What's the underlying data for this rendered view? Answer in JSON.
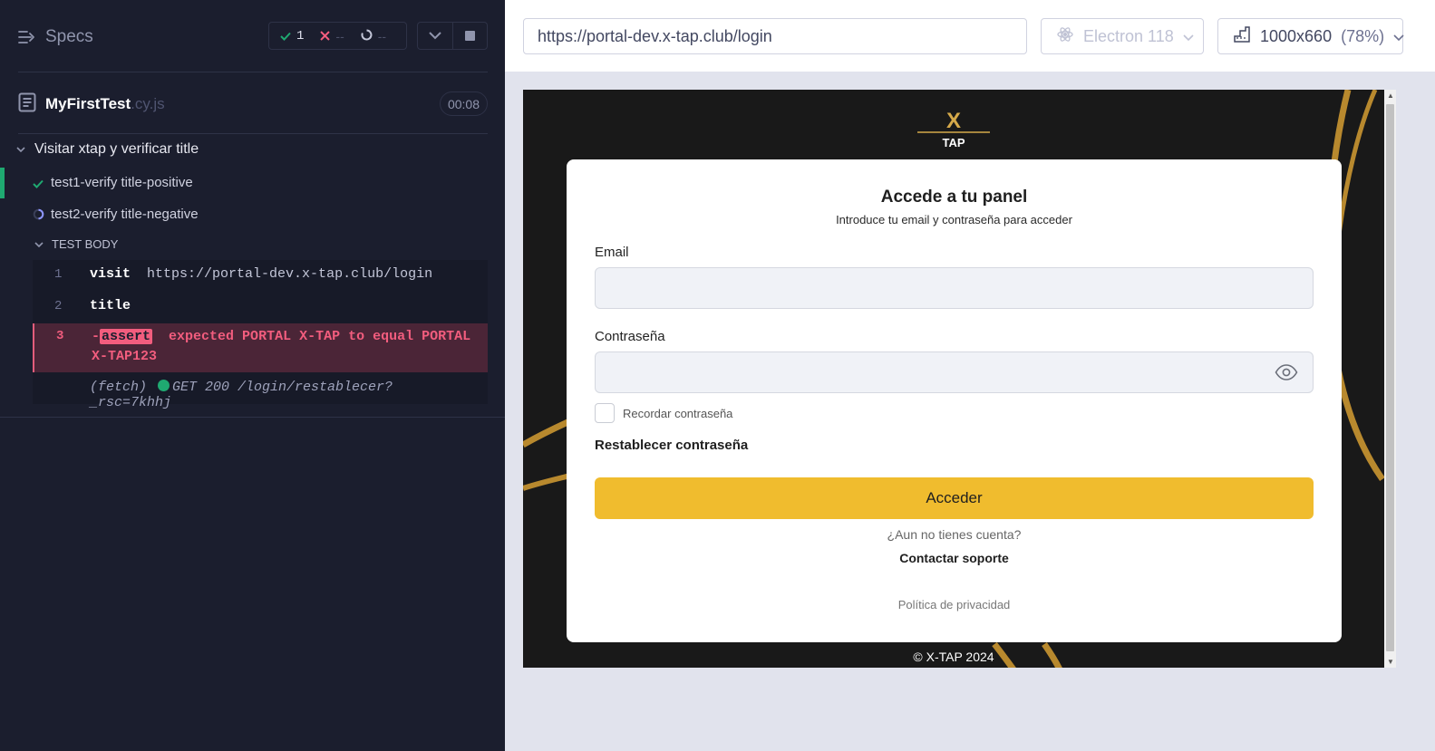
{
  "reporter": {
    "specs_label": "Specs",
    "stats": {
      "passed": "1",
      "failed": "--",
      "pending": "--"
    },
    "file": {
      "name": "MyFirstTest",
      "ext": ".cy.js",
      "duration": "00:08"
    },
    "suite": {
      "title": "Visitar xtap y verificar title"
    },
    "tests": [
      {
        "title": "test1-verify title-positive",
        "state": "passed"
      },
      {
        "title": "test2-verify title-negative",
        "state": "running"
      }
    ],
    "test_body_label": "TEST BODY",
    "commands": [
      {
        "num": "1",
        "name": "visit",
        "arg": "https://portal-dev.x-tap.club/login"
      },
      {
        "num": "2",
        "name": "title",
        "arg": ""
      },
      {
        "num": "3",
        "prefix": "-",
        "name": "assert",
        "arg": "expected PORTAL X-TAP to equal PORTAL X-TAP123"
      },
      {
        "num": "",
        "name": "(fetch)",
        "arg": "GET 200 /login/restablecer?_rsc=7khhj"
      }
    ]
  },
  "browser": {
    "url": "https://portal-dev.x-tap.club/login",
    "browser_name": "Electron 118",
    "viewport": "1000x660",
    "zoom": "(78%)"
  },
  "app": {
    "logo_text": "X",
    "logo_subtext": "TAP",
    "title": "Accede a tu panel",
    "subtitle": "Introduce tu email y contraseña para acceder",
    "email_label": "Email",
    "email_value": "",
    "password_label": "Contraseña",
    "password_value": "",
    "remember_label": "Recordar contraseña",
    "reset_label": "Restablecer contraseña",
    "submit_label": "Acceder",
    "no_account_text": "¿Aun no tienes cuenta?",
    "contact_label": "Contactar soporte",
    "privacy_label": "Política de privacidad",
    "copyright": "© X-TAP 2024"
  },
  "colors": {
    "reporter_bg": "#1b1e2e",
    "pass": "#1fa971",
    "fail": "#f25d7e",
    "accent": "#f0bc2e",
    "gold_swoosh": "#b8892e"
  }
}
